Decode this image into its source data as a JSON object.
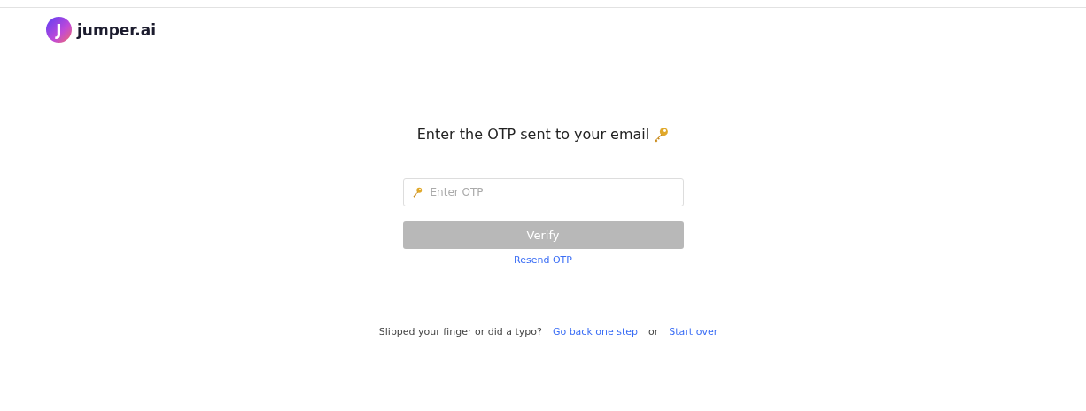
{
  "logo": {
    "mark": "J",
    "name": "jumper.ai"
  },
  "heading": "Enter the OTP sent to your email",
  "otp_field": {
    "placeholder": "Enter OTP"
  },
  "verify_button": {
    "label": "Verify",
    "disabled": true
  },
  "resend_link": "Resend OTP",
  "footer": {
    "text": "Slipped your finger or did a typo?",
    "back_link": "Go back one step",
    "separator": "or",
    "restart_link": "Start over"
  }
}
